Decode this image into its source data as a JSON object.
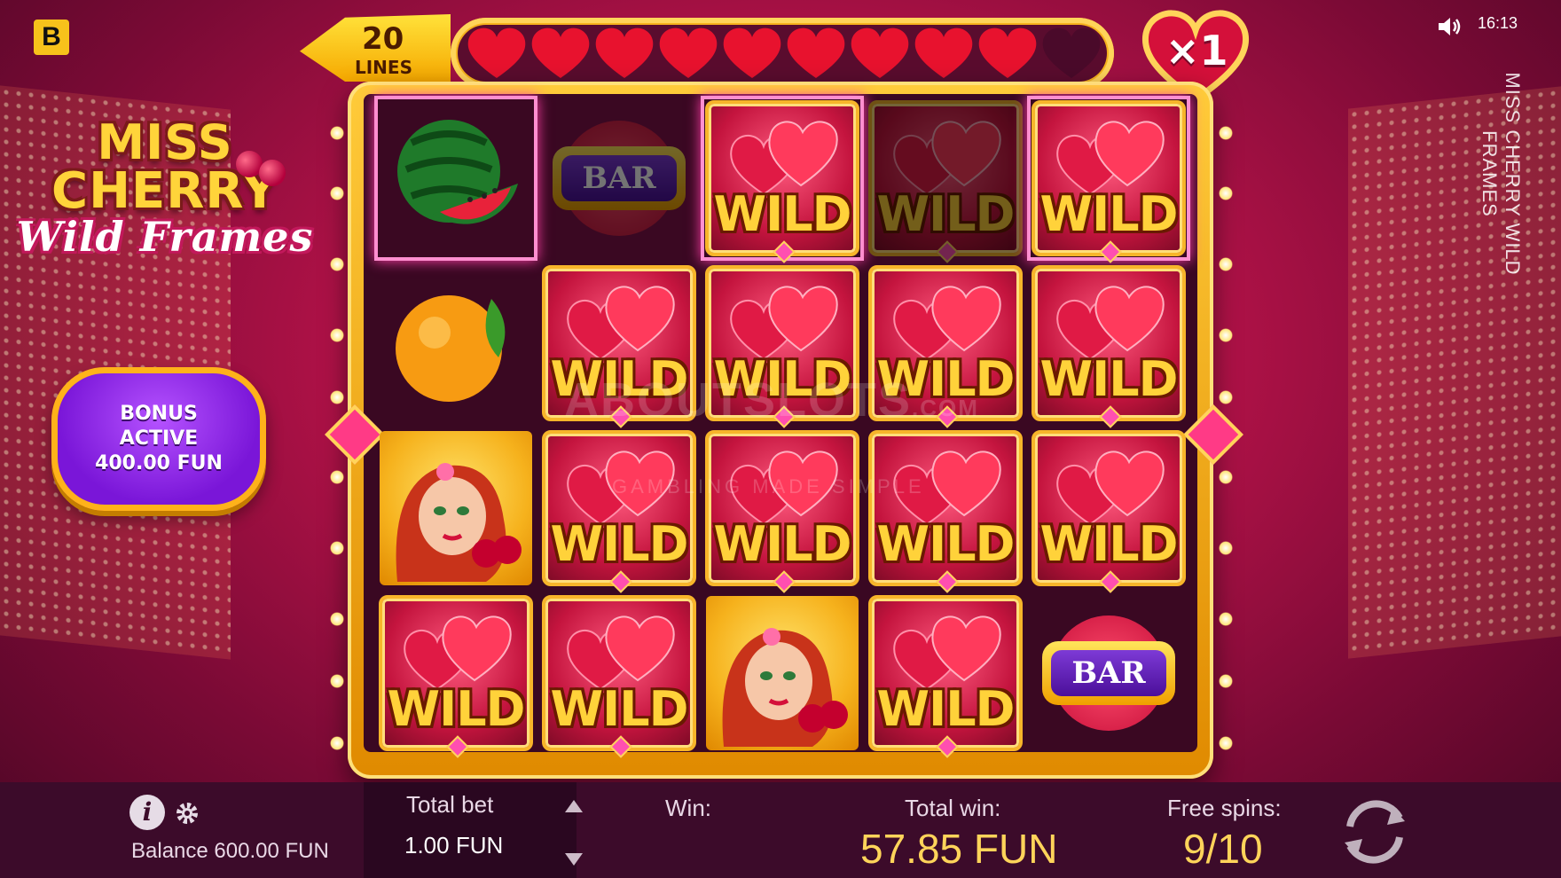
{
  "brand": {
    "badge": "B"
  },
  "game": {
    "title_line1": "MISS",
    "title_line2": "CHERRY",
    "title_line3": "Wild Frames",
    "vertical_title": "MISS CHERRY WILD FRAMES"
  },
  "bonus": {
    "line1": "BONUS",
    "line2": "ACTIVE",
    "line3": "400.00 FUN"
  },
  "lines": {
    "count": "20",
    "label": "LINES"
  },
  "hearts_meter": {
    "filled": 9,
    "total": 10
  },
  "multiplier": "×1",
  "clock": "16:13",
  "reels": [
    [
      "watermelon",
      "bar-dim",
      "wild",
      "wild-dim",
      "wild"
    ],
    [
      "orange",
      "wild",
      "wild",
      "wild",
      "wild"
    ],
    [
      "miss-cherry",
      "wild",
      "wild",
      "wild",
      "wild"
    ],
    [
      "wild",
      "wild",
      "miss-cherry",
      "wild",
      "bar"
    ]
  ],
  "symbol_text": {
    "wild": "WILD",
    "bar": "BAR"
  },
  "watermark": {
    "main": "ABOUTSLOTS",
    "sub": "GAMBLING MADE SIMPLE",
    "suffix": ".COM"
  },
  "bottom": {
    "balance": "Balance 600.00 FUN",
    "total_bet_label": "Total bet",
    "total_bet_value": "1.00 FUN",
    "win_label": "Win:",
    "total_win_label": "Total win:",
    "total_win_value": "57.85 FUN",
    "free_spins_label": "Free spins:",
    "free_spins_value": "9/10"
  },
  "colors": {
    "accent_gold": "#ffd45a",
    "bonus_purple": "#8a22e6",
    "heart_red": "#e8122e"
  }
}
